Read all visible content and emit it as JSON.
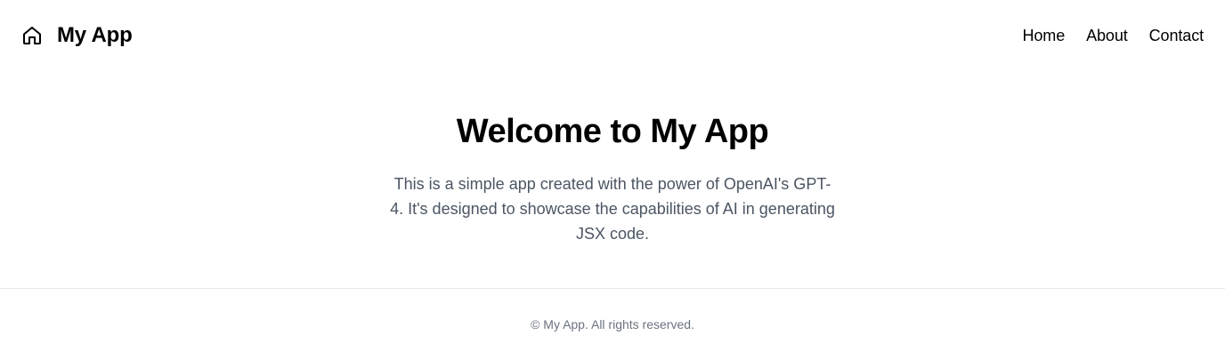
{
  "header": {
    "brand_icon": "home-icon",
    "title": "My App",
    "nav": [
      {
        "label": "Home"
      },
      {
        "label": "About"
      },
      {
        "label": "Contact"
      }
    ]
  },
  "main": {
    "heading": "Welcome to My App",
    "description": "This is a simple app created with the power of OpenAI's GPT-4. It's designed to showcase the capabilities of AI in generating JSX code."
  },
  "footer": {
    "copyright": "© My App. All rights reserved."
  },
  "colors": {
    "text": "#000000",
    "muted": "#4b5563",
    "footer_text": "#6b7280",
    "divider": "#e5e7eb",
    "background": "#ffffff"
  }
}
